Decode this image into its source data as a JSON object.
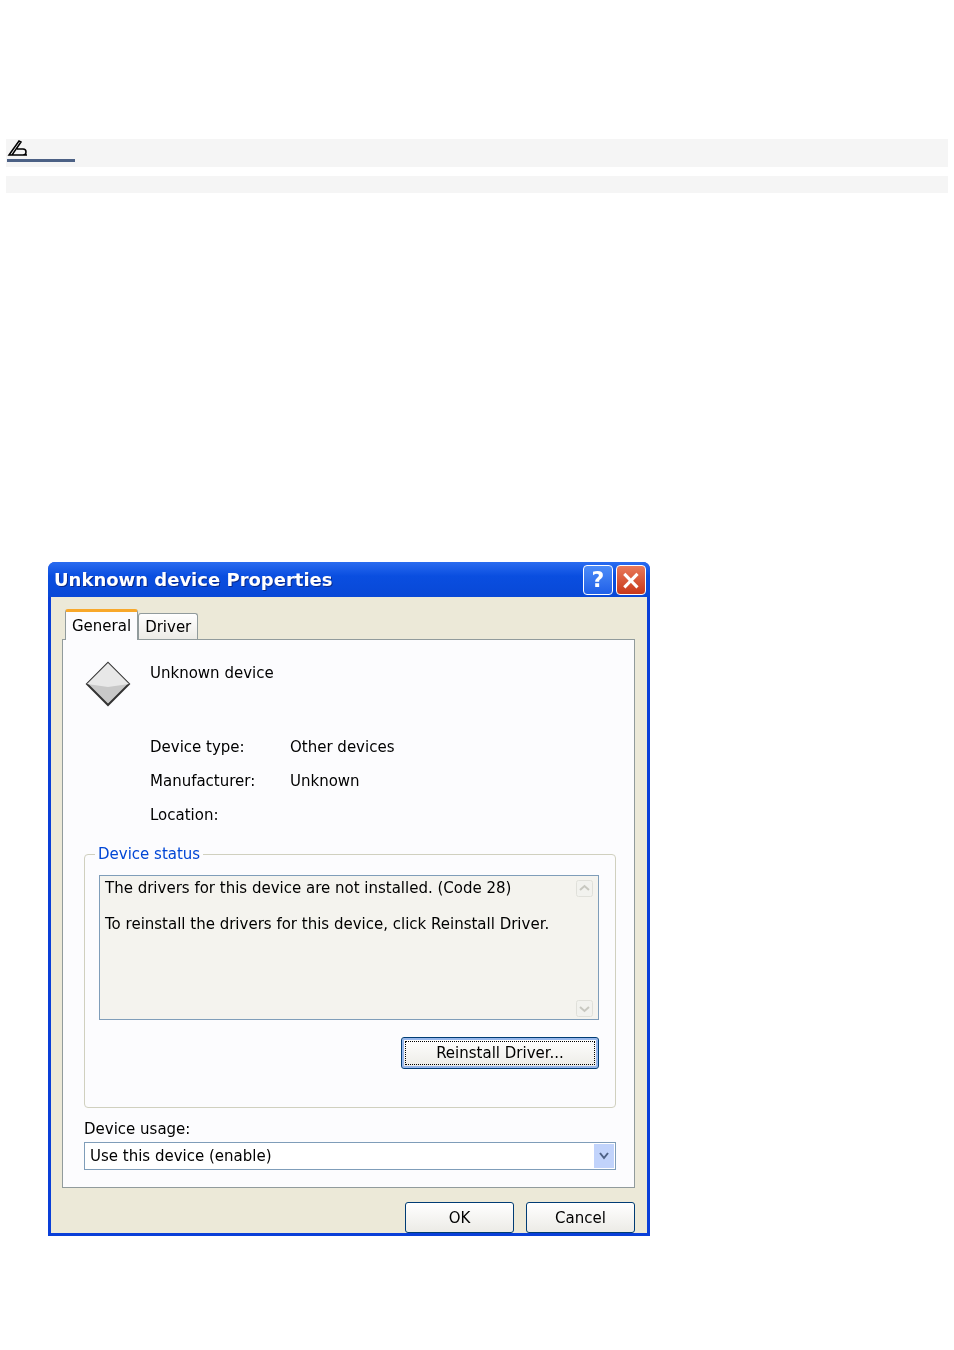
{
  "window": {
    "title": "Unknown device Properties"
  },
  "title_buttons": [
    {
      "kind": "help",
      "label": "?"
    },
    {
      "kind": "close",
      "label": "×"
    }
  ],
  "tabs": [
    {
      "label": "General",
      "selected": true
    },
    {
      "label": "Driver",
      "selected": false
    }
  ],
  "device": {
    "name": "Unknown device"
  },
  "properties": [
    {
      "label": "Device type:",
      "value": "Other devices"
    },
    {
      "label": "Manufacturer:",
      "value": "Unknown"
    },
    {
      "label": "Location:"
    }
  ],
  "device_status": {
    "title": "Device status",
    "lines": [
      "The drivers for this device are not installed. (Code 28)",
      "To reinstall the drivers for this device, click Reinstall Driver."
    ],
    "button": "Reinstall Driver..."
  },
  "device_usage": {
    "label": "Device usage:",
    "value": "Use this device (enable)"
  },
  "buttons": [
    "OK",
    "Cancel"
  ]
}
